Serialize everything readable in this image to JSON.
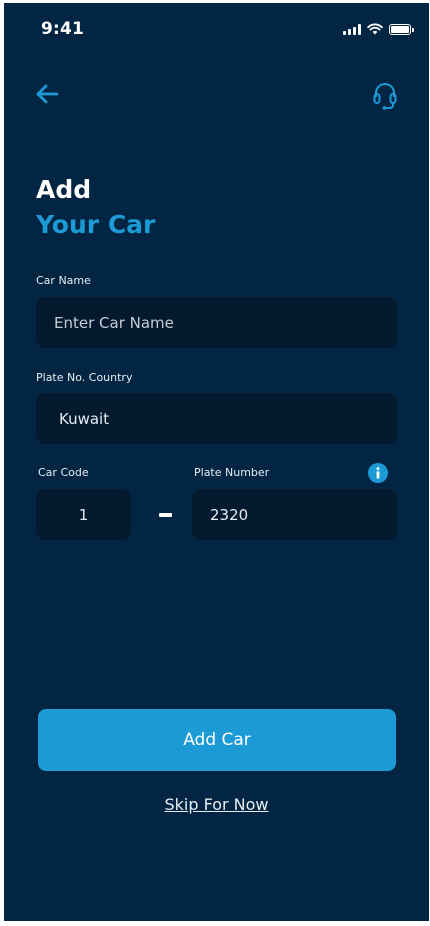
{
  "status_bar": {
    "time": "9:41"
  },
  "header": {
    "back_icon": "arrow-left-icon",
    "support_icon": "headset-icon"
  },
  "title": {
    "line1": "Add",
    "line2": "Your Car"
  },
  "form": {
    "car_name": {
      "label": "Car Name",
      "placeholder": "Enter Car Name",
      "value": ""
    },
    "plate_country": {
      "label": "Plate No. Country",
      "value": "Kuwait"
    },
    "car_code": {
      "label": "Car Code",
      "value": "1"
    },
    "plate_number": {
      "label": "Plate Number",
      "value": "2320"
    }
  },
  "actions": {
    "add_car": "Add Car",
    "skip": "Skip For Now"
  },
  "colors": {
    "background": "#012542",
    "field": "#03192e",
    "accent": "#1c9ad6"
  }
}
